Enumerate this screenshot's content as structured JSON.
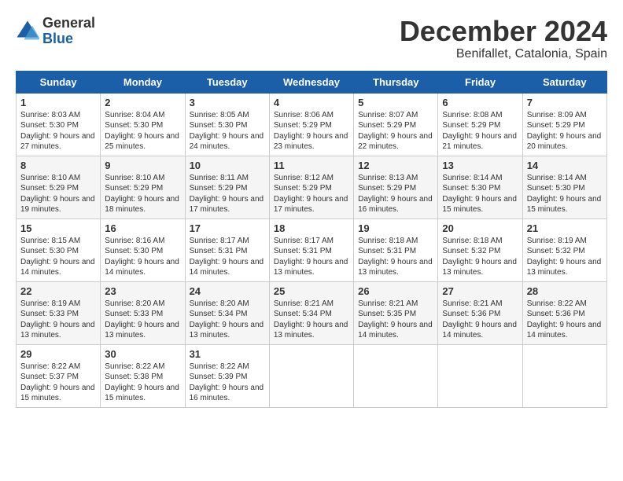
{
  "header": {
    "logo_general": "General",
    "logo_blue": "Blue",
    "month": "December 2024",
    "location": "Benifallet, Catalonia, Spain"
  },
  "weekdays": [
    "Sunday",
    "Monday",
    "Tuesday",
    "Wednesday",
    "Thursday",
    "Friday",
    "Saturday"
  ],
  "weeks": [
    [
      {
        "day": "1",
        "sunrise": "8:03 AM",
        "sunset": "5:30 PM",
        "daylight": "9 hours and 27 minutes."
      },
      {
        "day": "2",
        "sunrise": "8:04 AM",
        "sunset": "5:30 PM",
        "daylight": "9 hours and 25 minutes."
      },
      {
        "day": "3",
        "sunrise": "8:05 AM",
        "sunset": "5:30 PM",
        "daylight": "9 hours and 24 minutes."
      },
      {
        "day": "4",
        "sunrise": "8:06 AM",
        "sunset": "5:29 PM",
        "daylight": "9 hours and 23 minutes."
      },
      {
        "day": "5",
        "sunrise": "8:07 AM",
        "sunset": "5:29 PM",
        "daylight": "9 hours and 22 minutes."
      },
      {
        "day": "6",
        "sunrise": "8:08 AM",
        "sunset": "5:29 PM",
        "daylight": "9 hours and 21 minutes."
      },
      {
        "day": "7",
        "sunrise": "8:09 AM",
        "sunset": "5:29 PM",
        "daylight": "9 hours and 20 minutes."
      }
    ],
    [
      {
        "day": "8",
        "sunrise": "8:10 AM",
        "sunset": "5:29 PM",
        "daylight": "9 hours and 19 minutes."
      },
      {
        "day": "9",
        "sunrise": "8:10 AM",
        "sunset": "5:29 PM",
        "daylight": "9 hours and 18 minutes."
      },
      {
        "day": "10",
        "sunrise": "8:11 AM",
        "sunset": "5:29 PM",
        "daylight": "9 hours and 17 minutes."
      },
      {
        "day": "11",
        "sunrise": "8:12 AM",
        "sunset": "5:29 PM",
        "daylight": "9 hours and 17 minutes."
      },
      {
        "day": "12",
        "sunrise": "8:13 AM",
        "sunset": "5:29 PM",
        "daylight": "9 hours and 16 minutes."
      },
      {
        "day": "13",
        "sunrise": "8:14 AM",
        "sunset": "5:30 PM",
        "daylight": "9 hours and 15 minutes."
      },
      {
        "day": "14",
        "sunrise": "8:14 AM",
        "sunset": "5:30 PM",
        "daylight": "9 hours and 15 minutes."
      }
    ],
    [
      {
        "day": "15",
        "sunrise": "8:15 AM",
        "sunset": "5:30 PM",
        "daylight": "9 hours and 14 minutes."
      },
      {
        "day": "16",
        "sunrise": "8:16 AM",
        "sunset": "5:30 PM",
        "daylight": "9 hours and 14 minutes."
      },
      {
        "day": "17",
        "sunrise": "8:17 AM",
        "sunset": "5:31 PM",
        "daylight": "9 hours and 14 minutes."
      },
      {
        "day": "18",
        "sunrise": "8:17 AM",
        "sunset": "5:31 PM",
        "daylight": "9 hours and 13 minutes."
      },
      {
        "day": "19",
        "sunrise": "8:18 AM",
        "sunset": "5:31 PM",
        "daylight": "9 hours and 13 minutes."
      },
      {
        "day": "20",
        "sunrise": "8:18 AM",
        "sunset": "5:32 PM",
        "daylight": "9 hours and 13 minutes."
      },
      {
        "day": "21",
        "sunrise": "8:19 AM",
        "sunset": "5:32 PM",
        "daylight": "9 hours and 13 minutes."
      }
    ],
    [
      {
        "day": "22",
        "sunrise": "8:19 AM",
        "sunset": "5:33 PM",
        "daylight": "9 hours and 13 minutes."
      },
      {
        "day": "23",
        "sunrise": "8:20 AM",
        "sunset": "5:33 PM",
        "daylight": "9 hours and 13 minutes."
      },
      {
        "day": "24",
        "sunrise": "8:20 AM",
        "sunset": "5:34 PM",
        "daylight": "9 hours and 13 minutes."
      },
      {
        "day": "25",
        "sunrise": "8:21 AM",
        "sunset": "5:34 PM",
        "daylight": "9 hours and 13 minutes."
      },
      {
        "day": "26",
        "sunrise": "8:21 AM",
        "sunset": "5:35 PM",
        "daylight": "9 hours and 14 minutes."
      },
      {
        "day": "27",
        "sunrise": "8:21 AM",
        "sunset": "5:36 PM",
        "daylight": "9 hours and 14 minutes."
      },
      {
        "day": "28",
        "sunrise": "8:22 AM",
        "sunset": "5:36 PM",
        "daylight": "9 hours and 14 minutes."
      }
    ],
    [
      {
        "day": "29",
        "sunrise": "8:22 AM",
        "sunset": "5:37 PM",
        "daylight": "9 hours and 15 minutes."
      },
      {
        "day": "30",
        "sunrise": "8:22 AM",
        "sunset": "5:38 PM",
        "daylight": "9 hours and 15 minutes."
      },
      {
        "day": "31",
        "sunrise": "8:22 AM",
        "sunset": "5:39 PM",
        "daylight": "9 hours and 16 minutes."
      },
      null,
      null,
      null,
      null
    ]
  ]
}
